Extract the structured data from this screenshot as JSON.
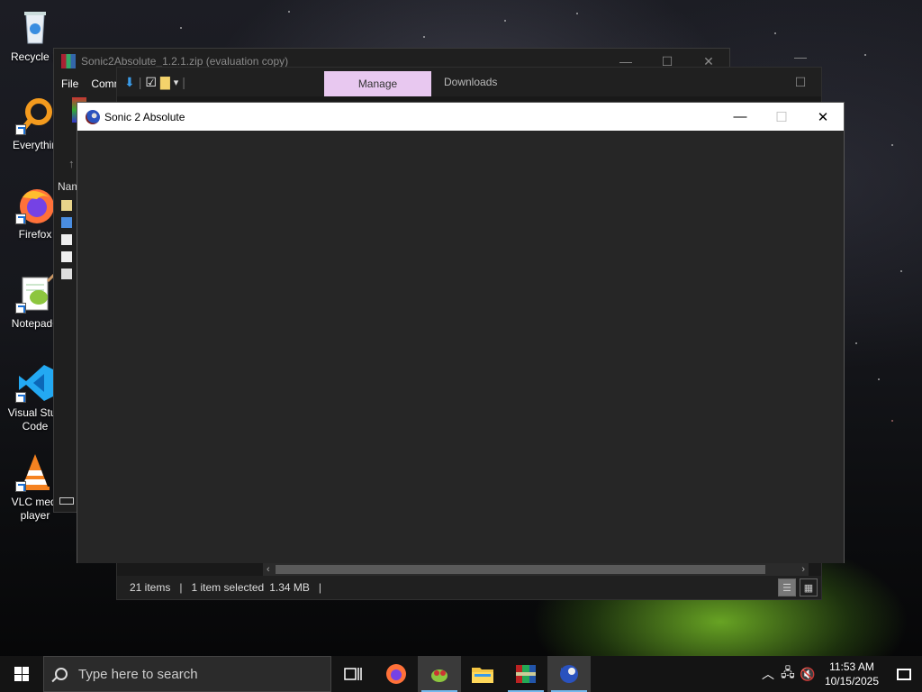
{
  "desktop": {
    "icons": [
      {
        "label": "Recycle B"
      },
      {
        "label": "Everythin"
      },
      {
        "label": "Firefox"
      },
      {
        "label": "Notepad+"
      },
      {
        "label": "Visual Stud Code"
      },
      {
        "label": "VLC medi player"
      }
    ]
  },
  "winrar": {
    "title": "Sonic2Absolute_1.2.1.zip (evaluation copy)",
    "menu": [
      "File",
      "Comn"
    ],
    "column_fragment": "Nam"
  },
  "explorer": {
    "manage_tab": "Manage",
    "location": "Downloads",
    "status": {
      "items": "21 items",
      "selected": "1 item selected",
      "size": "1.34 MB"
    }
  },
  "sonic_window": {
    "title": "Sonic 2 Absolute"
  },
  "taskbar": {
    "search_placeholder": "Type here to search",
    "time": "11:53 AM",
    "date": "10/15/2025"
  }
}
